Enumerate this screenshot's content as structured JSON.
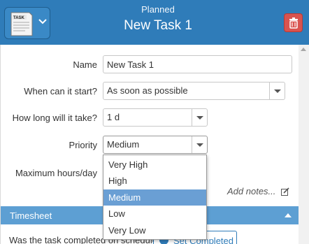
{
  "header": {
    "status": "Planned",
    "title": "New Task 1",
    "type_icon_text": "TASK",
    "accent": "#2f7cb9"
  },
  "form": {
    "name_label": "Name",
    "name_value": "New Task 1",
    "start_label": "When can it start?",
    "start_value": "As soon as possible",
    "duration_label": "How long will it take?",
    "duration_value": "1 d",
    "priority_label": "Priority",
    "priority_value": "Medium",
    "max_hours_label": "Maximum hours/day",
    "add_notes": "Add notes..."
  },
  "priority_options": [
    "Very High",
    "High",
    "Medium",
    "Low",
    "Very Low"
  ],
  "priority_selected": "Medium",
  "timesheet": {
    "title": "Timesheet",
    "question": "Was the task completed on schedule?",
    "set_completed": "Set Completed"
  },
  "icons": {
    "type": "task-document-icon",
    "chevron": "chevron-down-icon",
    "delete": "trash-icon",
    "notes": "edit-icon",
    "completed": "check-circle-icon"
  }
}
